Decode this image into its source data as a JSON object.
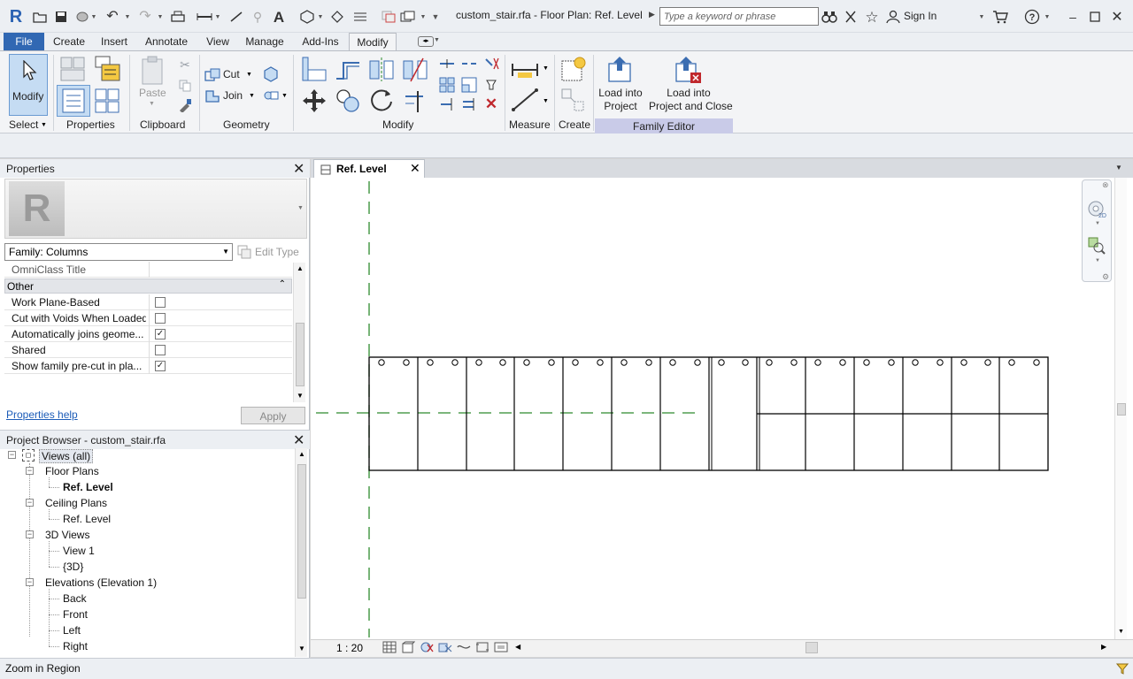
{
  "titlebar": {
    "app_icon": "R",
    "title": "custom_stair.rfa - Floor Plan: Ref. Level",
    "search_placeholder": "Type a keyword or phrase",
    "sign_in": "Sign In"
  },
  "tabs": [
    "File",
    "Create",
    "Insert",
    "Annotate",
    "View",
    "Manage",
    "Add-Ins",
    "Modify"
  ],
  "ribbon": {
    "modify_label": "Modify",
    "cut_label": "Cut",
    "join_label": "Join",
    "paste_label": "Paste",
    "load_into_project": "Load into\nProject",
    "load_into_project_l1": "Load into",
    "load_into_project_l2": "Project",
    "load_close_l1": "Load into",
    "load_close_l2": "Project and Close",
    "panels": {
      "select": "Select",
      "properties": "Properties",
      "clipboard": "Clipboard",
      "geometry": "Geometry",
      "modify": "Modify",
      "measure": "Measure",
      "create": "Create",
      "family_editor": "Family Editor"
    }
  },
  "properties_panel": {
    "title": "Properties",
    "type_selector": "Family: Columns",
    "edit_type": "Edit Type",
    "omniclass_title": "OmniClass Title",
    "group_other": "Other",
    "rows": [
      {
        "name": "Work Plane-Based",
        "checked": false,
        "mark": ""
      },
      {
        "name": "Cut with Voids When Loaded",
        "checked": false,
        "mark": ""
      },
      {
        "name": "Automatically joins geome...",
        "checked": true,
        "mark": "✓"
      },
      {
        "name": "Shared",
        "checked": false,
        "mark": ""
      },
      {
        "name": "Show family pre-cut in pla...",
        "checked": true,
        "mark": "✓"
      }
    ],
    "help_link": "Properties help",
    "apply": "Apply"
  },
  "project_browser": {
    "title": "Project Browser - custom_stair.rfa",
    "root": "Views (all)",
    "groups": {
      "floor_plans": "Floor Plans",
      "floor_ref_level": "Ref. Level",
      "ceiling_plans": "Ceiling Plans",
      "ceiling_ref_level": "Ref. Level",
      "views_3d": "3D Views",
      "view1": "View 1",
      "view3d": "{3D}",
      "elevations": "Elevations (Elevation 1)",
      "back": "Back",
      "front": "Front",
      "left": "Left",
      "right": "Right"
    }
  },
  "view": {
    "tab_label": "Ref. Level",
    "scale": "1 : 20"
  },
  "status": {
    "text": "Zoom in Region"
  },
  "colors": {
    "file_tab": "#3168b3",
    "family_editor": "#c9cbe8",
    "ref_line": "#2e8b2e"
  }
}
